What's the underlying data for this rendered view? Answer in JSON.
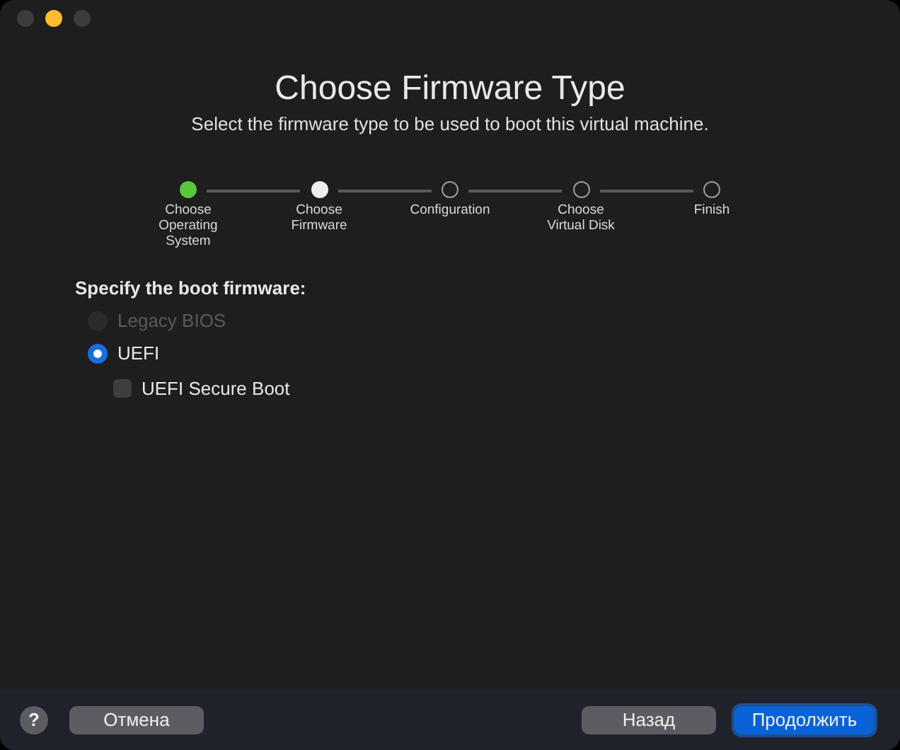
{
  "window": {
    "controls": [
      {
        "kind": "close",
        "enabled": false
      },
      {
        "kind": "minimize",
        "enabled": true
      },
      {
        "kind": "zoom",
        "enabled": false
      }
    ]
  },
  "title": "Choose Firmware Type",
  "subtitle": "Select the firmware type to be used to boot this virtual machine.",
  "steps": [
    {
      "label": "Choose Operating System",
      "done": true,
      "selected": false
    },
    {
      "label": "Choose Firmware",
      "done": false,
      "selected": true
    },
    {
      "label": "Configuration",
      "done": false,
      "selected": false
    },
    {
      "label": "Choose Virtual Disk",
      "done": false,
      "selected": false
    },
    {
      "label": "Finish",
      "done": false,
      "selected": false
    }
  ],
  "firmware": {
    "heading": "Specify the boot firmware:",
    "options": [
      {
        "label": "Legacy BIOS",
        "selected": false,
        "disabled": true
      },
      {
        "label": "UEFI",
        "selected": true,
        "disabled": false
      }
    ],
    "secure_boot": {
      "label": "UEFI Secure Boot",
      "checked": false
    }
  },
  "footer": {
    "help": "?",
    "left_buttons": [
      {
        "label": "Отмена",
        "kind": "default"
      }
    ],
    "right_buttons": [
      {
        "label": "Назад",
        "kind": "default"
      },
      {
        "label": "Продолжить",
        "kind": "primary"
      }
    ]
  }
}
